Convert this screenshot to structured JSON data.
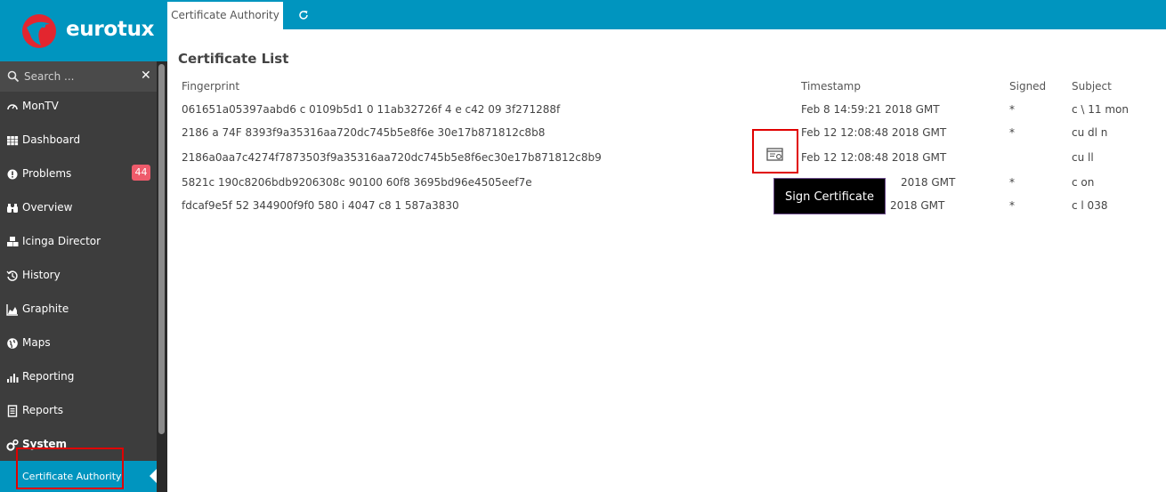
{
  "brand": {
    "name": "eurotux",
    "accent": "#0095bf",
    "logo_red": "#e3262f"
  },
  "sidebar": {
    "search_placeholder": "Search ...",
    "items": [
      {
        "label": "MonTV",
        "icon": "gauge-icon"
      },
      {
        "label": "Dashboard",
        "icon": "grid-icon"
      },
      {
        "label": "Problems",
        "icon": "alert-circle-icon",
        "badge": "44"
      },
      {
        "label": "Overview",
        "icon": "binoculars-icon"
      },
      {
        "label": "Icinga Director",
        "icon": "cubes-icon"
      },
      {
        "label": "History",
        "icon": "history-icon"
      },
      {
        "label": "Graphite",
        "icon": "area-chart-icon"
      },
      {
        "label": "Maps",
        "icon": "globe-icon"
      },
      {
        "label": "Reporting",
        "icon": "bar-chart-icon"
      },
      {
        "label": "Reports",
        "icon": "document-icon"
      },
      {
        "label": "System",
        "icon": "gears-icon"
      }
    ],
    "active_sub": "Certificate Authority"
  },
  "tabs": [
    {
      "label": "Certificate Authority"
    }
  ],
  "main": {
    "title": "Certificate List",
    "columns": [
      "Fingerprint",
      "Timestamp",
      "Signed",
      "Subject"
    ],
    "rows": [
      {
        "fingerprint": "061651a05397aabd6   c  0109b5d1 0     11ab32726f  4  e  c42     09  3f271288f",
        "timestamp": "Feb 8 14:59:21 2018 GMT",
        "signed": "*",
        "subject": "c         \\ 11 mon"
      },
      {
        "fingerprint": "2186       a       74F      8393f9a35316aa720dc745b5e8f6e  30e17b871812c8b8",
        "timestamp": "Feb 12 12:08:48 2018 GMT",
        "signed": "*",
        "subject": "cu  dl     n"
      },
      {
        "fingerprint": "2186a0aa7c4274f7873503f9a35316aa720dc745b5e8f6ec30e17b871812c8b9",
        "timestamp": "Feb 12 12:08:48 2018 GMT",
        "signed": "",
        "subject": "cu       ll"
      },
      {
        "fingerprint": "5821c             190c8206bdb9206308c       90100  60f8     3695bd96e4505eef7e",
        "timestamp": "2018 GMT",
        "signed": "*",
        "subject": "c             on"
      },
      {
        "fingerprint": "fdcaf9e5f      52  344900f9f0 580        i 4047       c8     1   587a3830",
        "timestamp": "2018 GMT",
        "signed": "*",
        "subject": "c         l     038"
      }
    ],
    "tooltip": "Sign Certificate"
  }
}
